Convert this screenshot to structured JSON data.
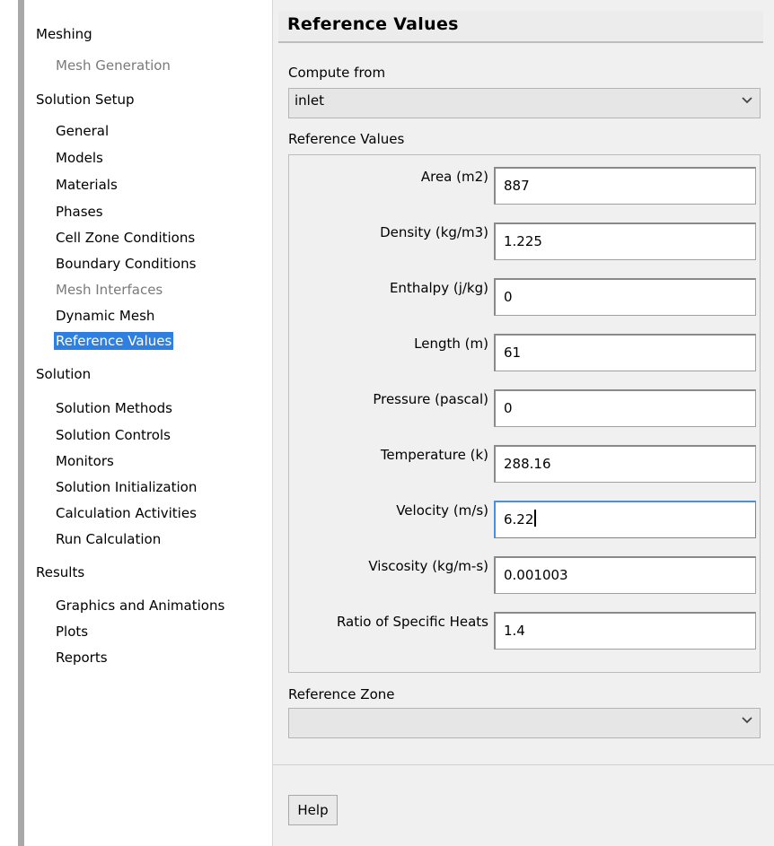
{
  "nav": {
    "meshing": {
      "label": "Meshing",
      "items": [
        "Mesh Generation"
      ]
    },
    "solution_setup": {
      "label": "Solution Setup",
      "items": [
        "General",
        "Models",
        "Materials",
        "Phases",
        "Cell Zone Conditions",
        "Boundary Conditions",
        "Mesh Interfaces",
        "Dynamic Mesh",
        "Reference Values"
      ]
    },
    "solution": {
      "label": "Solution",
      "items": [
        "Solution Methods",
        "Solution Controls",
        "Monitors",
        "Solution Initialization",
        "Calculation Activities",
        "Run Calculation"
      ]
    },
    "results": {
      "label": "Results",
      "items": [
        "Graphics and Animations",
        "Plots",
        "Reports"
      ]
    },
    "selected": "Reference Values",
    "disabled": [
      "Mesh Generation",
      "Mesh Interfaces"
    ]
  },
  "panel": {
    "title": "Reference Values",
    "compute_from": {
      "label": "Compute from",
      "value": "inlet"
    },
    "group_label": "Reference Values",
    "fields": [
      {
        "label": "Area (m2)",
        "value": "887"
      },
      {
        "label": "Density (kg/m3)",
        "value": "1.225"
      },
      {
        "label": "Enthalpy (j/kg)",
        "value": "0"
      },
      {
        "label": "Length (m)",
        "value": "61"
      },
      {
        "label": "Pressure (pascal)",
        "value": "0"
      },
      {
        "label": "Temperature (k)",
        "value": "288.16"
      },
      {
        "label": "Velocity (m/s)",
        "value": "6.22"
      },
      {
        "label": "Viscosity (kg/m-s)",
        "value": "0.001003"
      },
      {
        "label": "Ratio of Specific Heats",
        "value": "1.4"
      }
    ],
    "reference_zone": {
      "label": "Reference Zone",
      "value": ""
    },
    "help_label": "Help"
  },
  "icons": {
    "dropdown": "chevron-down-icon"
  },
  "colors": {
    "selection": "#2f7fe0",
    "focus_border": "#4a90d9",
    "disabled_text": "#7a7a7a"
  }
}
